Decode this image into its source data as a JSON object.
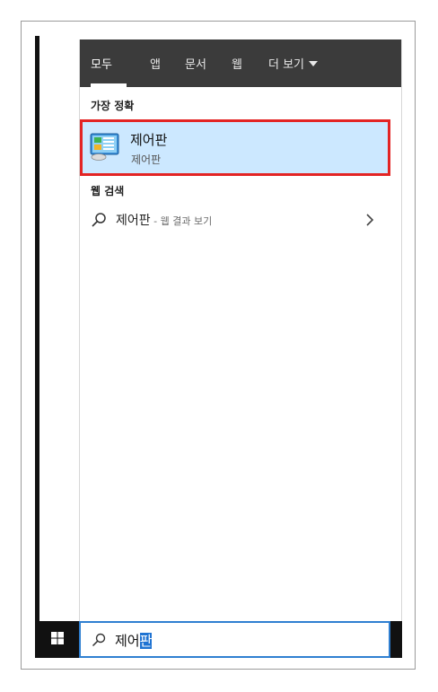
{
  "tabs": [
    {
      "label": "모두",
      "active": true
    },
    {
      "label": "앱",
      "active": false
    },
    {
      "label": "문서",
      "active": false
    },
    {
      "label": "웹",
      "active": false
    },
    {
      "label": "더 보기",
      "active": false
    }
  ],
  "best_match": {
    "section_label": "가장 정확",
    "title": "제어판",
    "subtitle": "제어판",
    "icon": "control-panel-icon"
  },
  "web_search": {
    "section_label": "웹 검색",
    "query": "제어판",
    "suffix": " - 웹 결과 보기",
    "icon": "search-icon"
  },
  "search_box": {
    "text_plain": "제어",
    "text_selected": "판",
    "icon": "search-icon"
  },
  "colors": {
    "tab_bar": "#3b3b3b",
    "selection": "#cce8ff",
    "highlight_border": "#e32424",
    "search_border": "#2f7fd1"
  }
}
